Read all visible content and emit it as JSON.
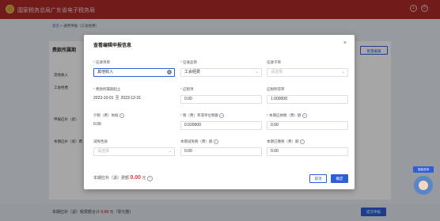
{
  "header": {
    "site_title": "国家税务总局广东省电子税务局"
  },
  "breadcrumb": {
    "home": "首页",
    "separator": ">",
    "current": "通用申报（工会经费）"
  },
  "background": {
    "period_label": "费款所属期",
    "batch_edit_button": "批量编辑",
    "rows": [
      "其他收入",
      "工会经费",
      "申报应补（退）",
      "本期应补（退）费"
    ]
  },
  "bottom_bar": {
    "text_prefix": "本期应补（退）税费额合计",
    "amount": "0.00",
    "text_suffix": "元（零元整）",
    "submit_button": "提交申报"
  },
  "dialog": {
    "title": "查看编辑申报信息",
    "fields": {
      "levy_item": {
        "label": "征收项目",
        "value": "其他收入"
      },
      "levy_category": {
        "label": "征收品目",
        "value": "工会经费"
      },
      "levy_subitem": {
        "label": "征收子目",
        "placeholder": "请选择"
      },
      "period": {
        "label": "费款所属期起止",
        "start": "2023-10-01",
        "separator": "至",
        "end": "2023-12-31"
      },
      "basis": {
        "label": "应税项",
        "value": "0.00"
      },
      "deduction_ratio": {
        "label": "应税所得率",
        "value": "1.000000"
      },
      "tax_basis": {
        "label": "计税（费）依据",
        "value": "0.00"
      },
      "rate": {
        "label": "税（费）率或单位税额",
        "value": "0.020000"
      },
      "payable": {
        "label": "本期应纳税（费）额",
        "value": "0.00"
      },
      "relief_nature": {
        "label": "减免性质",
        "placeholder": "请选择"
      },
      "relief_amount": {
        "label": "本期减免税（费）额",
        "value": "0.00"
      },
      "paid_amount": {
        "label": "本期已缴税（费）额",
        "value": "0.00"
      }
    },
    "total": {
      "prefix": "本期应补（退）费额",
      "amount": "0.00",
      "unit": "元"
    },
    "cancel_button": "取消",
    "confirm_button": "确定"
  },
  "assistant": {
    "label": "智能咨询"
  }
}
